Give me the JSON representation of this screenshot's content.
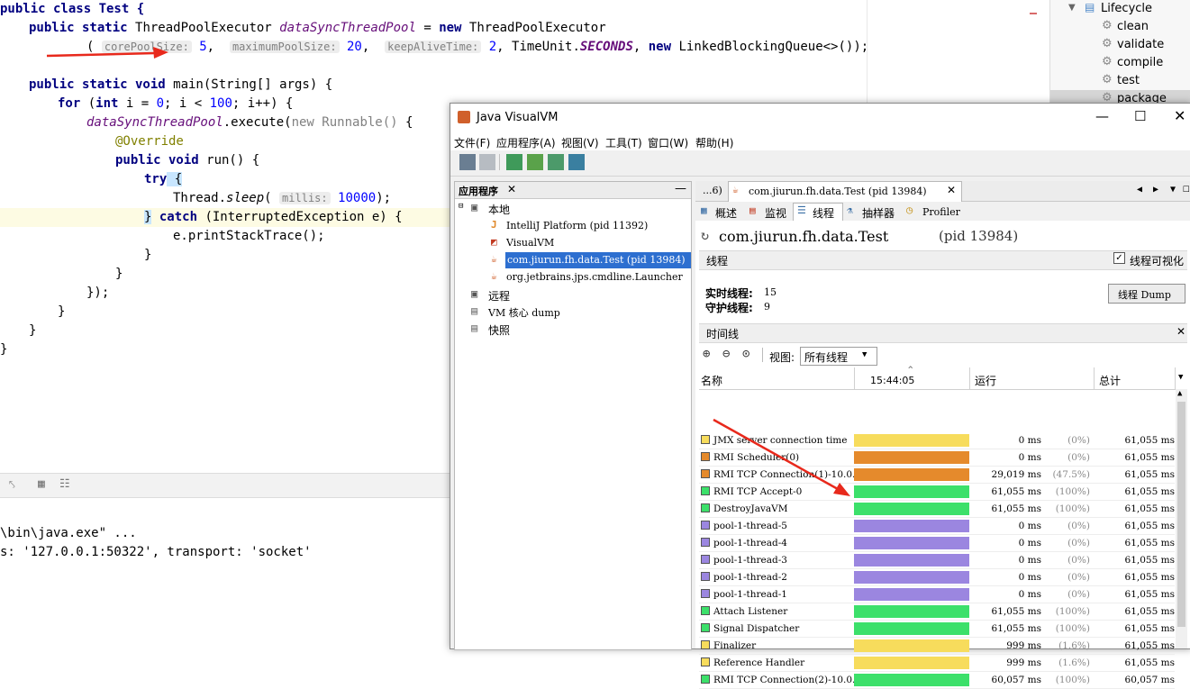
{
  "editor": {
    "class_decl": "public class Test {",
    "field_line": {
      "kw1": "public static ",
      "type": "ThreadPoolExecutor ",
      "name": "dataSyncThreadPool",
      "eq": " = ",
      "kw_new": "new",
      "ctor": " ThreadPoolExecutor"
    },
    "ctor_args": {
      "open": "(",
      "hint1": "corePoolSize:",
      "v1": " 5",
      "hint2": "maximumPoolSize:",
      "v2": " 20",
      "hint3": "keepAliveTime:",
      "v3": " 2",
      "unit_prefix": ", TimeUnit.",
      "unit": "SECONDS",
      "tail_comma": ", ",
      "kw_new": "new",
      "queue": " LinkedBlockingQueue<>());"
    },
    "main_decl": {
      "kw": "public static void",
      "rest": " main(String[] args) {"
    },
    "for_line": {
      "kw": "for",
      "p1": " (",
      "kw_int": "int",
      "rest": " i = ",
      "n0": "0",
      "mid": "; i < ",
      "n100": "100",
      "end": "; i++) {"
    },
    "execute_line": {
      "field": "dataSyncThreadPool",
      "mid": ".execute(",
      "kw_new": "new",
      "cls": " Runnable()",
      "end": " {"
    },
    "override": "@Override",
    "run_decl": {
      "kw": "public void",
      "rest": " run() {"
    },
    "try_kw": "try",
    "try_brace": " {",
    "sleep_line": {
      "pre": "Thread.",
      "method": "sleep",
      "open": "(",
      "hint": "millis:",
      "num": " 10000",
      "close": ");"
    },
    "catch_line": {
      "brace": "}",
      "kw": " catch",
      "rest": " (InterruptedException e) {"
    },
    "print_line": "e.printStackTrace();",
    "close1": "}",
    "close2": "}",
    "close3": "});",
    "close4": "}",
    "close5": "}",
    "close6": "}"
  },
  "run_panel": {
    "line1": "\\bin\\java.exe\" ...",
    "line2": "s: '127.0.0.1:50322', transport: 'socket'"
  },
  "maven": {
    "lifecycle": "Lifecycle",
    "items": [
      "clean",
      "validate",
      "compile",
      "test",
      "package"
    ]
  },
  "visualvm": {
    "title": "Java VisualVM",
    "menu": [
      "文件(F)",
      "应用程序(A)",
      "视图(V)",
      "工具(T)",
      "窗口(W)",
      "帮助(H)"
    ],
    "apps_tab": "应用程序",
    "tree": {
      "local": "本地",
      "apps": [
        "IntelliJ Platform (pid 11392)",
        "VisualVM",
        "com.jiurun.fh.data.Test (pid 13984)",
        "org.jetbrains.jps.cmdline.Launcher"
      ],
      "remote": "远程",
      "vm_dump": "VM 核心 dump",
      "snapshots": "快照"
    },
    "tab_prev": "...6)",
    "tab_active": "com.jiurun.fh.data.Test (pid 13984)",
    "subtabs": [
      "概述",
      "监视",
      "线程",
      "抽样器",
      "Profiler"
    ],
    "heading": "com.jiurun.fh.data.Test",
    "heading_pid": "(pid 13984)",
    "threads_section": "线程",
    "visualize_label": "线程可视化",
    "live_label": "实时线程:",
    "live_value": "15",
    "daemon_label": "守护线程:",
    "daemon_value": "9",
    "dump_button": "线程 Dump",
    "timeline_section": "时间线",
    "view_label": "视图:",
    "view_value": "所有线程",
    "col_name": "名称",
    "col_time": "15:44:05",
    "col_run": "运行",
    "col_total": "总计",
    "colors": {
      "running": "#3ce06a",
      "sleeping": "#9b86e0",
      "wait": "#f7dc5c",
      "monitor": "#e58a2c"
    },
    "threads": [
      {
        "name": "JMX server connection time",
        "state": "wait",
        "run": "0",
        "pct": "(0%)",
        "total": "61,055"
      },
      {
        "name": "RMI Scheduler(0)",
        "state": "monitor",
        "run": "0",
        "pct": "(0%)",
        "total": "61,055"
      },
      {
        "name": "RMI TCP Connection(1)-10.0.",
        "state": "monitor",
        "run": "29,019",
        "pct": "(47.5%)",
        "total": "61,055"
      },
      {
        "name": "RMI TCP Accept-0",
        "state": "running",
        "run": "61,055",
        "pct": "(100%)",
        "total": "61,055"
      },
      {
        "name": "DestroyJavaVM",
        "state": "running",
        "run": "61,055",
        "pct": "(100%)",
        "total": "61,055"
      },
      {
        "name": "pool-1-thread-5",
        "state": "sleeping",
        "run": "0",
        "pct": "(0%)",
        "total": "61,055"
      },
      {
        "name": "pool-1-thread-4",
        "state": "sleeping",
        "run": "0",
        "pct": "(0%)",
        "total": "61,055"
      },
      {
        "name": "pool-1-thread-3",
        "state": "sleeping",
        "run": "0",
        "pct": "(0%)",
        "total": "61,055"
      },
      {
        "name": "pool-1-thread-2",
        "state": "sleeping",
        "run": "0",
        "pct": "(0%)",
        "total": "61,055"
      },
      {
        "name": "pool-1-thread-1",
        "state": "sleeping",
        "run": "0",
        "pct": "(0%)",
        "total": "61,055"
      },
      {
        "name": "Attach Listener",
        "state": "running",
        "run": "61,055",
        "pct": "(100%)",
        "total": "61,055"
      },
      {
        "name": "Signal Dispatcher",
        "state": "running",
        "run": "61,055",
        "pct": "(100%)",
        "total": "61,055"
      },
      {
        "name": "Finalizer",
        "state": "wait",
        "run": "999",
        "pct": "(1.6%)",
        "total": "61,055"
      },
      {
        "name": "Reference Handler",
        "state": "wait",
        "run": "999",
        "pct": "(1.6%)",
        "total": "61,055"
      },
      {
        "name": "RMI TCP Connection(2)-10.0.",
        "state": "running",
        "run": "60,057",
        "pct": "(100%)",
        "total": "60,057"
      }
    ],
    "unit": "ms"
  }
}
